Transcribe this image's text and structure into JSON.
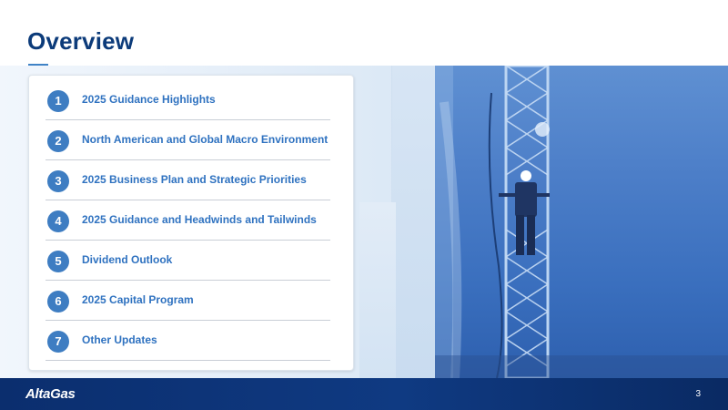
{
  "slide": {
    "title": "Overview",
    "page_number": "3"
  },
  "agenda": {
    "items": [
      {
        "number": "1",
        "label": "2025 Guidance Highlights"
      },
      {
        "number": "2",
        "label": "North American and Global Macro Environment"
      },
      {
        "number": "3",
        "label": "2025 Business Plan and Strategic Priorities"
      },
      {
        "number": "4",
        "label": "2025 Guidance and Headwinds and Tailwinds"
      },
      {
        "number": "5",
        "label": "Dividend Outlook"
      },
      {
        "number": "6",
        "label": "2025 Capital Program"
      },
      {
        "number": "7",
        "label": "Other Updates"
      }
    ]
  },
  "footer": {
    "logo_text": "AltaGas"
  },
  "colors": {
    "title": "#0c3b7a",
    "accent": "#3e7dc2",
    "item_text": "#2f72c0",
    "footer": "#0f3a82"
  }
}
